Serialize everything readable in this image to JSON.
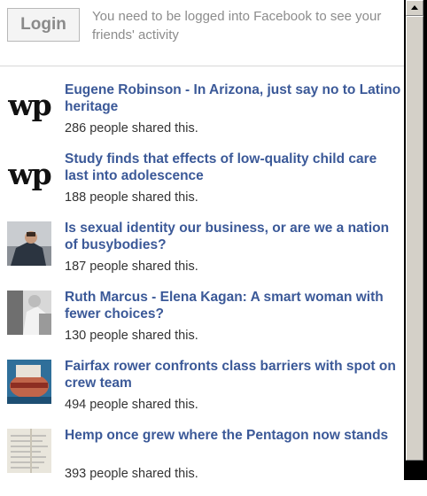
{
  "login": {
    "button_label": "Login",
    "message": "You need to be logged into Facebook to see your friends' activity"
  },
  "articles": [
    {
      "title": "Eugene Robinson - In Arizona, just say no to Latino heritage",
      "shares": "286 people shared this.",
      "thumb": "wp-logo"
    },
    {
      "title": "Study finds that effects of low-quality child care last into adolescence",
      "shares": "188 people shared this.",
      "thumb": "wp-logo"
    },
    {
      "title": "Is sexual identity our business, or are we a nation of busybodies?",
      "shares": "187 people shared this.",
      "thumb": "photo-man"
    },
    {
      "title": "Ruth Marcus - Elena Kagan: A smart woman with fewer choices?",
      "shares": "130 people shared this.",
      "thumb": "photo-kagan"
    },
    {
      "title": "Fairfax rower confronts class barriers with spot on crew team",
      "shares": "494 people shared this.",
      "thumb": "photo-rower"
    },
    {
      "title": "Hemp once grew where the Pentagon now stands",
      "shares": "393 people shared this.",
      "thumb": "photo-document"
    }
  ],
  "wp_logo_text": "wp",
  "colors": {
    "link": "#3b5998",
    "muted": "#8c8c8c"
  }
}
